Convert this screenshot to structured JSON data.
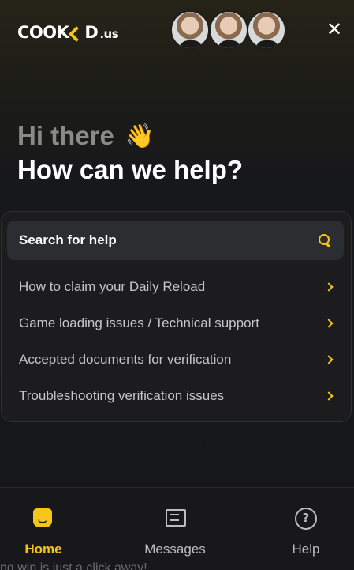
{
  "header": {
    "logo_left": "COOK",
    "logo_right": "D",
    "logo_tld": ".us",
    "close_glyph": "✕"
  },
  "greeting": {
    "hi": "Hi there",
    "wave": "👋",
    "title": "How can we help?"
  },
  "help_card": {
    "search_label": "Search for help",
    "items": [
      {
        "label": "How to claim your Daily Reload"
      },
      {
        "label": "Game loading issues / Technical support"
      },
      {
        "label": "Accepted documents for verification"
      },
      {
        "label": "Troubleshooting verification issues"
      }
    ]
  },
  "nav": {
    "home": "Home",
    "messages": "Messages",
    "help": "Help"
  },
  "background_text": "ng win is just a click away!",
  "colors": {
    "accent": "#f5c518",
    "background": "#161719",
    "card": "#1c1c1f",
    "search_bg": "#2c2d31"
  }
}
